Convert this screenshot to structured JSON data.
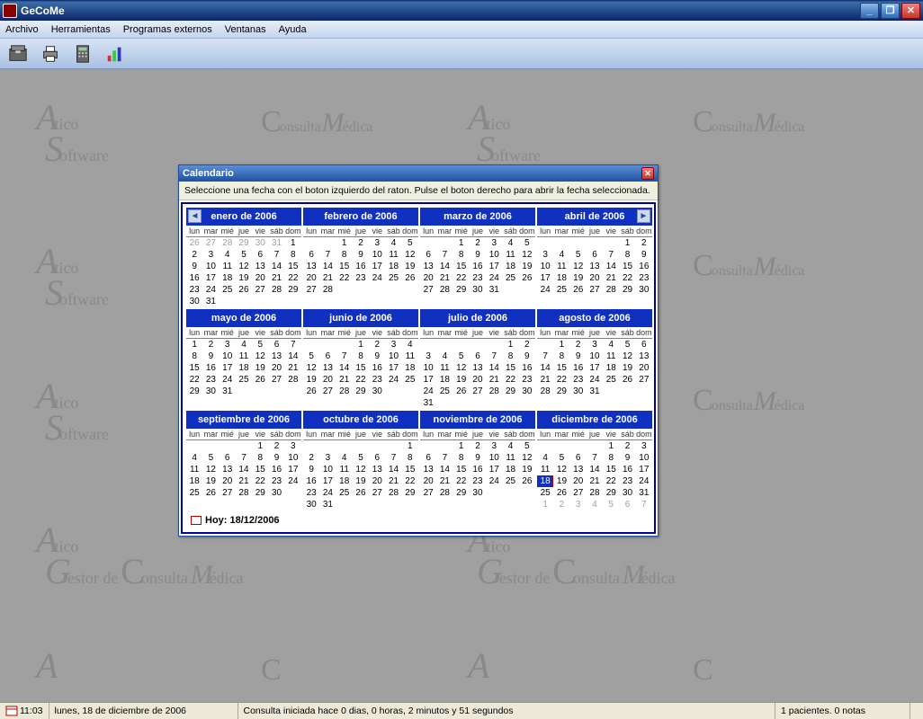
{
  "app": {
    "title": "GeCoMe"
  },
  "menu": [
    "Archivo",
    "Herramientas",
    "Programas externos",
    "Ventanas",
    "Ayuda"
  ],
  "watermark": {
    "line1a": "A",
    "line1b": "tico",
    "line2a": "S",
    "line2b": "oftware",
    "cmC": "C",
    "cmOnsulta": "onsulta",
    "cmM": "M",
    "cmEdica": "édica",
    "gA": "A",
    "gTico": "tico",
    "gS": "S",
    "gOftware": "oftware",
    "dG": "G",
    "dEstor": "estor de",
    "dC": "C",
    "dOnsulta": "onsulta",
    "dM": "M",
    "dEdica": "édica"
  },
  "dialog": {
    "title": "Calendario",
    "instruction": "Seleccione una fecha con el boton izquierdo del raton. Pulse el boton derecho para abrir la fecha seleccionada.",
    "today_label": "Hoy: 18/12/2006",
    "dow": [
      "lun",
      "mar",
      "mié",
      "jue",
      "vie",
      "sáb",
      "dom"
    ],
    "months": [
      {
        "name": "enero de 2006",
        "prev": true,
        "start": 6,
        "len": 31,
        "leading": [
          26,
          27,
          28,
          29,
          30,
          31
        ]
      },
      {
        "name": "febrero de 2006",
        "start": 2,
        "len": 28,
        "leading": []
      },
      {
        "name": "marzo de 2006",
        "start": 2,
        "len": 31,
        "leading": []
      },
      {
        "name": "abril de 2006",
        "next": true,
        "start": 5,
        "len": 30,
        "leading": []
      },
      {
        "name": "mayo de 2006",
        "start": 0,
        "len": 31,
        "leading": []
      },
      {
        "name": "junio de 2006",
        "start": 3,
        "len": 30,
        "leading": []
      },
      {
        "name": "julio de 2006",
        "start": 5,
        "len": 31,
        "leading": []
      },
      {
        "name": "agosto de 2006",
        "start": 1,
        "len": 31,
        "leading": []
      },
      {
        "name": "septiembre de 2006",
        "start": 4,
        "len": 30,
        "leading": []
      },
      {
        "name": "octubre de 2006",
        "start": 6,
        "len": 31,
        "leading": []
      },
      {
        "name": "noviembre de 2006",
        "start": 2,
        "len": 30,
        "leading": []
      },
      {
        "name": "diciembre de 2006",
        "start": 4,
        "len": 31,
        "leading": [],
        "today": 18,
        "trailing": [
          1,
          2,
          3,
          4,
          5,
          6,
          7
        ]
      }
    ]
  },
  "status": {
    "time": "11:03",
    "date": "lunes, 18 de diciembre de 2006",
    "session": "Consulta iniciada hace 0 dias, 0 horas, 2 minutos y 51 segundos",
    "patients": "1 pacientes. 0 notas"
  }
}
